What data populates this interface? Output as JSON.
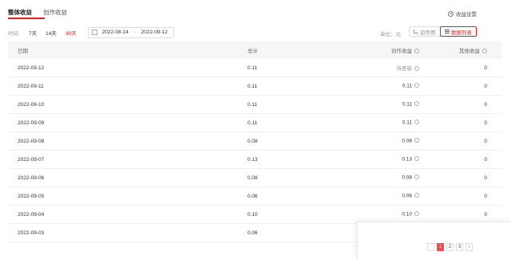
{
  "tabs": [
    {
      "label": "整体收益",
      "active": true
    },
    {
      "label": "创作收益",
      "active": false
    }
  ],
  "settings_label": "收益设置",
  "filter": {
    "time_label": "时间",
    "ranges": [
      {
        "label": "7天",
        "active": false
      },
      {
        "label": "14天",
        "active": false
      },
      {
        "label": "30天",
        "active": true
      }
    ],
    "start_date": "2022-08-14",
    "end_date": "2022-09-12",
    "date_separator": "~"
  },
  "unit_label": "单位：元",
  "view_buttons": {
    "chart": "趋势图",
    "list": "数据列表"
  },
  "table": {
    "headers": [
      "日期",
      "总计",
      "创作收益",
      "其他收益"
    ],
    "rows": [
      {
        "date": "2022-09-12",
        "total": "0.11",
        "creation": "待更新",
        "other": "0"
      },
      {
        "date": "2022-09-11",
        "total": "0.11",
        "creation": "0.11",
        "other": "0"
      },
      {
        "date": "2022-09-10",
        "total": "0.11",
        "creation": "0.11",
        "other": "0"
      },
      {
        "date": "2022-09-09",
        "total": "0.11",
        "creation": "0.11",
        "other": "0"
      },
      {
        "date": "2022-09-08",
        "total": "0.08",
        "creation": "0.08",
        "other": "0"
      },
      {
        "date": "2022-09-07",
        "total": "0.13",
        "creation": "0.13",
        "other": "0"
      },
      {
        "date": "2022-09-06",
        "total": "0.08",
        "creation": "0.08",
        "other": "0"
      },
      {
        "date": "2022-09-05",
        "total": "0.06",
        "creation": "0.06",
        "other": "0"
      },
      {
        "date": "2022-09-04",
        "total": "0.10",
        "creation": "0.10",
        "other": "0"
      },
      {
        "date": "2022-09-03",
        "total": "0.06",
        "creation": "0.06",
        "other": "0"
      }
    ]
  },
  "pagination": {
    "prev": "‹",
    "pages": [
      "1",
      "2",
      "3"
    ],
    "current": "1",
    "next": "›"
  },
  "colors": {
    "accent": "#e02020",
    "header_bg": "#f6f6f6"
  }
}
